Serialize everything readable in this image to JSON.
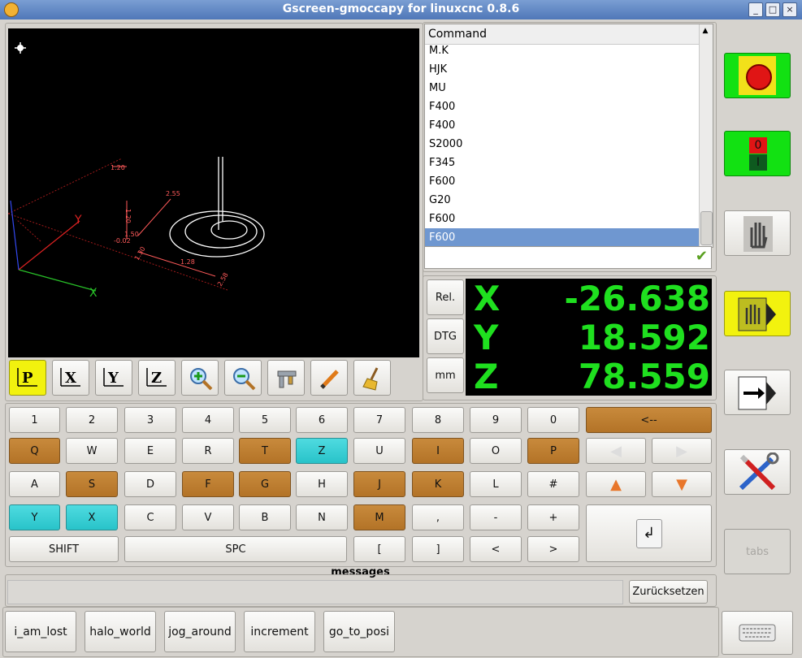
{
  "window": {
    "title": "Gscreen-gmoccapy for linuxcnc 0.8.6"
  },
  "viewport_labels": [
    "1.20",
    "1.20",
    "1.50",
    "2.55",
    "-0.02",
    "1.30",
    "1.28",
    "2.58",
    "X",
    "Y"
  ],
  "view_buttons": [
    {
      "name": "view-p-button",
      "label": "P"
    },
    {
      "name": "view-x-button",
      "label": "X"
    },
    {
      "name": "view-y-button",
      "label": "Y"
    },
    {
      "name": "view-z-button",
      "label": "Z"
    }
  ],
  "command": {
    "header": "Command",
    "items": [
      "M.K",
      "HJK",
      "MU",
      "F400",
      "F400",
      "S2000",
      "F345",
      "F600",
      "G20",
      "F600",
      "F600"
    ],
    "selected_index": 10,
    "input_value": ""
  },
  "dro_buttons": {
    "rel": "Rel.",
    "dtg": "DTG",
    "mm": "mm"
  },
  "dro": {
    "x_label": "X",
    "x_value": "-26.638",
    "y_label": "Y",
    "y_value": "18.592",
    "z_label": "Z",
    "z_value": "78.559"
  },
  "keyboard": {
    "row1": [
      "1",
      "2",
      "3",
      "4",
      "5",
      "6",
      "7",
      "8",
      "9",
      "0"
    ],
    "row2": [
      "Q",
      "W",
      "E",
      "R",
      "T",
      "Z",
      "U",
      "I",
      "O",
      "P"
    ],
    "row3": [
      "A",
      "S",
      "D",
      "F",
      "G",
      "H",
      "J",
      "K",
      "L",
      "#"
    ],
    "row4": [
      "Y",
      "X",
      "C",
      "V",
      "B",
      "N",
      "M",
      ",",
      "-",
      "+"
    ],
    "row5": [
      "[",
      "]",
      "<",
      ">"
    ],
    "backspace": "<--",
    "shift": "SHIFT",
    "space": "SPC",
    "enter_symbol": "↲"
  },
  "messages": {
    "label": "messages",
    "reset_button": "Zurücksetzen"
  },
  "side": {
    "tabs_label": "tabs",
    "estop_text": "Emergency Stop",
    "power_off": "0",
    "power_on": "I"
  },
  "macros": [
    "i_am_lost",
    "halo_world",
    "jog_around",
    "increment",
    "go_to_posi"
  ],
  "colors": {
    "orange": "#b97a2d",
    "cyan": "#38cfd4",
    "green": "#12e112",
    "yellow": "#f2f20e",
    "dro_text": "#1fe01f",
    "selection": "#6f97d0"
  }
}
